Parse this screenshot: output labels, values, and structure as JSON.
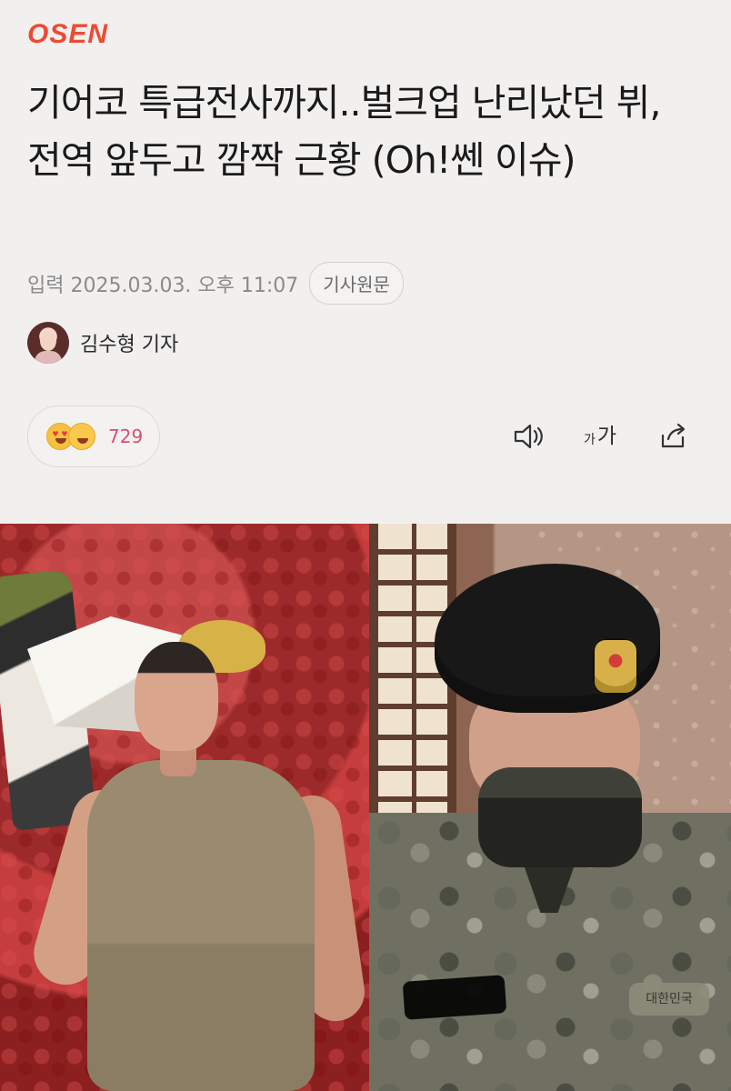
{
  "header": {
    "logo_text": "OSEN"
  },
  "article": {
    "title": "기어코 특급전사까지..벌크업 난리났던 뷔, 전역 앞두고 깜짝 근황 (Oh!쎈 이슈)",
    "published": "입력 2025.03.03. 오후 11:07",
    "original_label": "기사원문",
    "reporter": "김수형 기자"
  },
  "actions": {
    "reaction_count": "729",
    "font_small": "가",
    "font_large": "가"
  },
  "photo": {
    "name_tape": "대한민국"
  },
  "colors": {
    "logo": "#ed4a33",
    "reaction_count": "#d94d6d",
    "background": "#f2f0ef"
  },
  "icons": {
    "speaker": "speaker-icon",
    "font_size": "font-size-icon",
    "share": "share-icon"
  }
}
